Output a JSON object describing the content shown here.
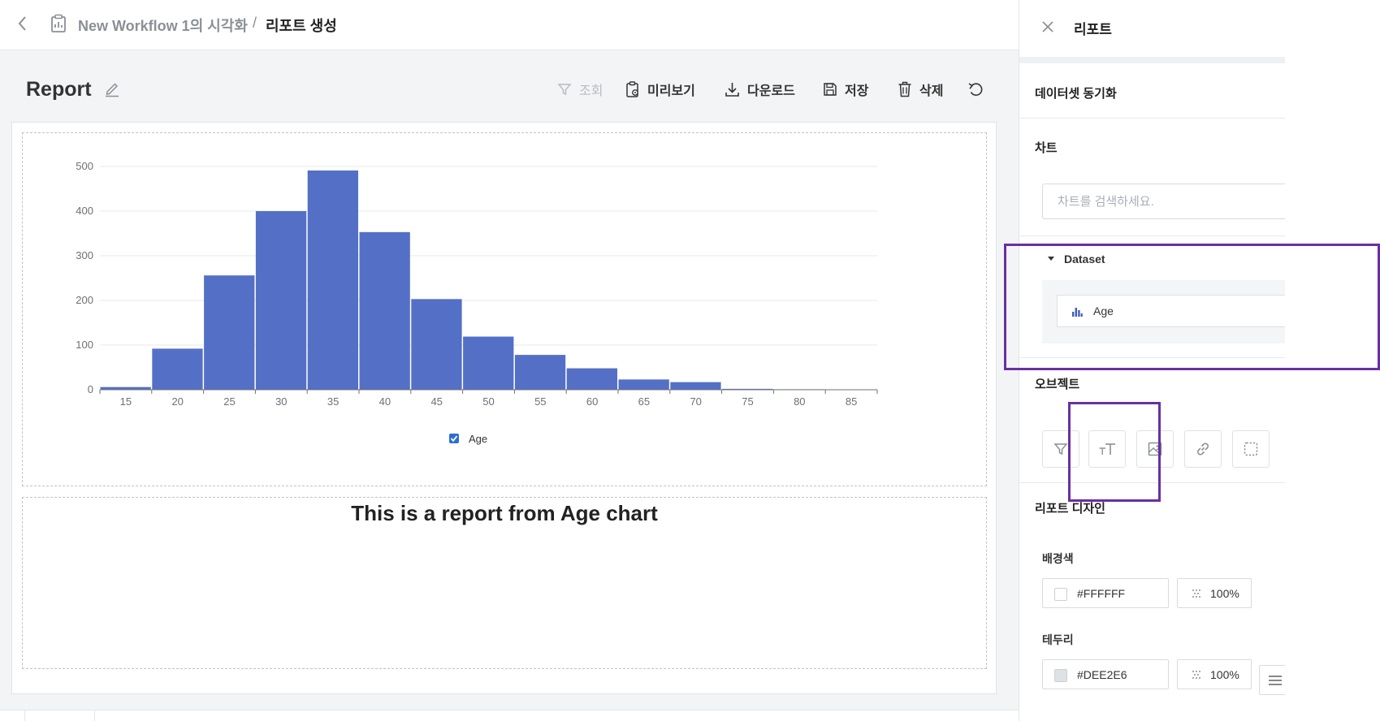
{
  "breadcrumb": {
    "parent": "New Workflow 1의 시각화",
    "separator": "/",
    "current": "리포트 생성"
  },
  "report": {
    "title": "Report"
  },
  "toolbar": {
    "filter_label": "조회",
    "preview_label": "미리보기",
    "download_label": "다운로드",
    "save_label": "저장",
    "delete_label": "삭제"
  },
  "chart_data": {
    "type": "bar",
    "categories": [
      "15",
      "20",
      "25",
      "30",
      "35",
      "40",
      "45",
      "50",
      "55",
      "60",
      "65",
      "70",
      "75",
      "80",
      "85"
    ],
    "series": [
      {
        "name": "Age",
        "values": [
          6,
          92,
          256,
          400,
          491,
          353,
          203,
          119,
          78,
          48,
          23,
          17,
          2,
          1,
          0
        ]
      }
    ],
    "yticks": [
      0,
      100,
      200,
      300,
      400,
      500
    ],
    "ylim": [
      0,
      500
    ],
    "legend": "bottom-center",
    "grid": true,
    "color": "#5470c6"
  },
  "text_object": {
    "content": "This is a report from Age chart"
  },
  "panel": {
    "title": "리포트",
    "sync_label": "데이터셋 동기화",
    "chart_section": "차트",
    "chart_search_placeholder": "차트를 검색하세요.",
    "dataset_label": "Dataset",
    "dataset_item": "Age",
    "objects_section": "오브젝트",
    "design_section": "리포트 디자인",
    "background_label": "배경색",
    "background_color": "#FFFFFF",
    "background_opacity": "100%",
    "border_label": "테두리",
    "border_color": "#DEE2E6",
    "border_opacity": "100%"
  },
  "colors": {
    "accent_highlight": "#6a2fa0",
    "bar": "#5470c6",
    "background_swatch": "#FFFFFF",
    "border_swatch": "#DEE2E6"
  }
}
